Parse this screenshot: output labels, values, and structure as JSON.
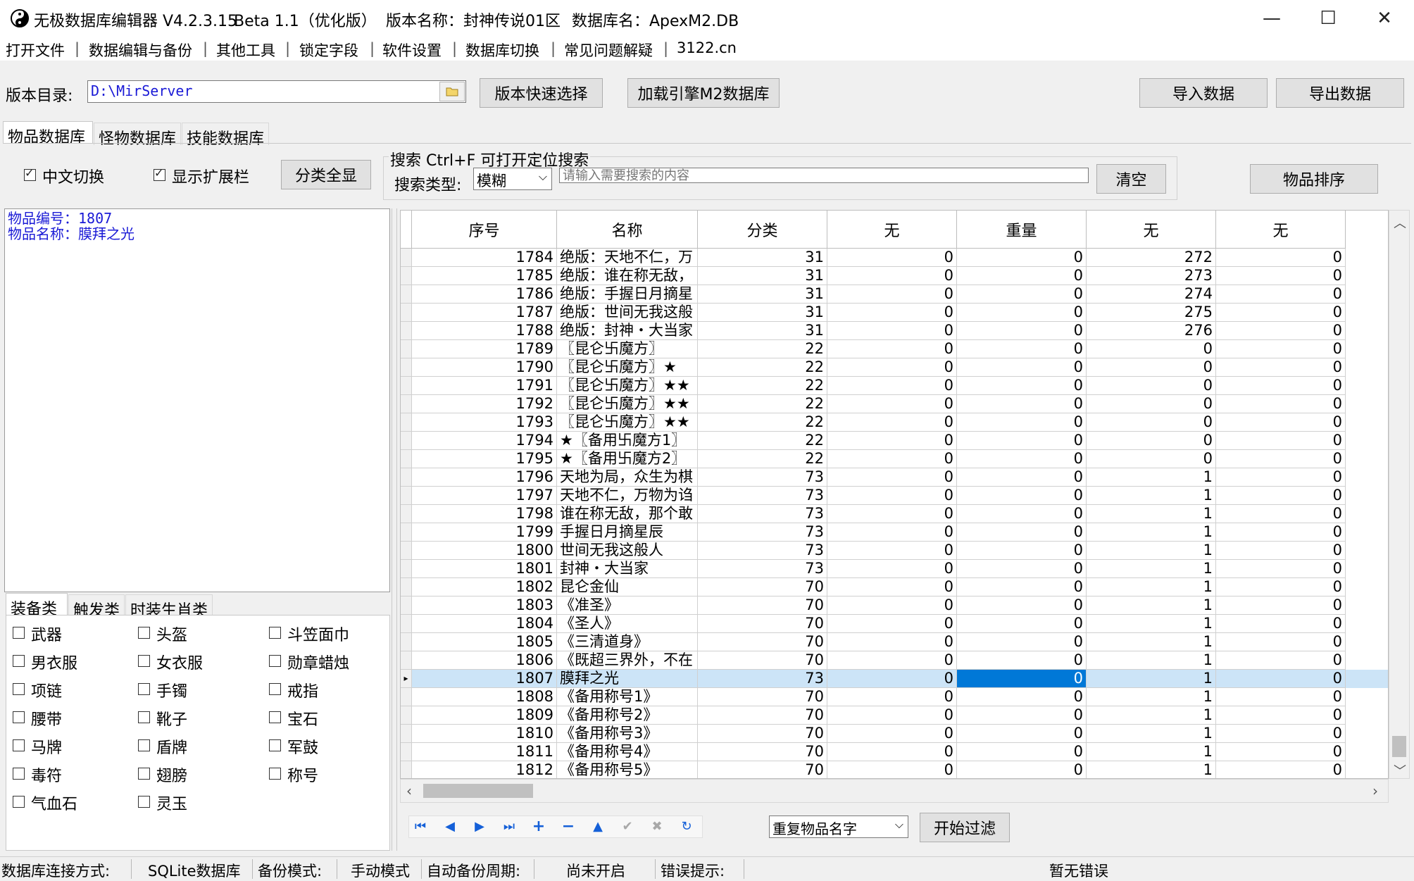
{
  "window": {
    "title_app": "无极数据库编辑器 V4.2.3.15",
    "title_edition": "Beta 1.1（优化版）",
    "title_version": "版本名称：封神传说01区",
    "title_db": "数据库名：ApexM2.DB",
    "minimize": "—",
    "maximize": "☐",
    "close": "✕"
  },
  "menu": [
    "打开文件",
    "数据编辑与备份",
    "其他工具",
    "锁定字段",
    "软件设置",
    "数据库切换",
    "常见问题解疑",
    "3122.cn"
  ],
  "toolbar": {
    "dir_label": "版本目录:",
    "dir_value": "D:\\MirServer",
    "quick_select": "版本快速选择",
    "load_engine": "加载引擎M2数据库",
    "import": "导入数据",
    "export": "导出数据"
  },
  "db_tabs": [
    "物品数据库",
    "怪物数据库",
    "技能数据库"
  ],
  "options": {
    "chinese_switch": "中文切换",
    "show_ext": "显示扩展栏",
    "show_all": "分类全显"
  },
  "search": {
    "group_title": "搜索  Ctrl+F 可打开定位搜索",
    "type_label": "搜索类型:",
    "type_value": "模糊",
    "placeholder": "请输入需要搜索的内容",
    "clear": "清空",
    "sort": "物品排序"
  },
  "info": {
    "line1": "物品编号：1807",
    "line2": "物品名称：膜拜之光"
  },
  "cat_tabs": [
    "装备类",
    "触发类",
    "时装生肖类"
  ],
  "categories": [
    [
      "武器",
      "头盔",
      "斗笠面巾"
    ],
    [
      "男衣服",
      "女衣服",
      "勋章蜡烛"
    ],
    [
      "项链",
      "手镯",
      "戒指"
    ],
    [
      "腰带",
      "靴子",
      "宝石"
    ],
    [
      "马牌",
      "盾牌",
      "军鼓"
    ],
    [
      "毒符",
      "翅膀",
      "称号"
    ],
    [
      "气血石",
      "灵玉"
    ]
  ],
  "grid": {
    "columns": [
      "序号",
      "名称",
      "分类",
      "无",
      "重量",
      "无",
      "无"
    ],
    "selected_id": "1807",
    "rows": [
      [
        "1784",
        "绝版：天地不仁，万",
        "31",
        "0",
        "0",
        "272",
        "0"
      ],
      [
        "1785",
        "绝版：谁在称无敌，",
        "31",
        "0",
        "0",
        "273",
        "0"
      ],
      [
        "1786",
        "绝版：手握日月摘星",
        "31",
        "0",
        "0",
        "274",
        "0"
      ],
      [
        "1787",
        "绝版：世间无我这般",
        "31",
        "0",
        "0",
        "275",
        "0"
      ],
      [
        "1788",
        "绝版：封神・大当家",
        "31",
        "0",
        "0",
        "276",
        "0"
      ],
      [
        "1789",
        "〖昆仑卐魔方〗",
        "22",
        "0",
        "0",
        "0",
        "0"
      ],
      [
        "1790",
        "〖昆仑卐魔方〗★",
        "22",
        "0",
        "0",
        "0",
        "0"
      ],
      [
        "1791",
        "〖昆仑卐魔方〗★★",
        "22",
        "0",
        "0",
        "0",
        "0"
      ],
      [
        "1792",
        "〖昆仑卐魔方〗★★",
        "22",
        "0",
        "0",
        "0",
        "0"
      ],
      [
        "1793",
        "〖昆仑卐魔方〗★★",
        "22",
        "0",
        "0",
        "0",
        "0"
      ],
      [
        "1794",
        "★〖备用卐魔方1〗",
        "22",
        "0",
        "0",
        "0",
        "0"
      ],
      [
        "1795",
        "★〖备用卐魔方2〗",
        "22",
        "0",
        "0",
        "0",
        "0"
      ],
      [
        "1796",
        "天地为局，众生为棋",
        "73",
        "0",
        "0",
        "1",
        "0"
      ],
      [
        "1797",
        "天地不仁，万物为诌",
        "73",
        "0",
        "0",
        "1",
        "0"
      ],
      [
        "1798",
        "谁在称无敌，那个敢",
        "73",
        "0",
        "0",
        "1",
        "0"
      ],
      [
        "1799",
        "手握日月摘星辰",
        "73",
        "0",
        "0",
        "1",
        "0"
      ],
      [
        "1800",
        "世间无我这般人",
        "73",
        "0",
        "0",
        "1",
        "0"
      ],
      [
        "1801",
        "封神・大当家",
        "73",
        "0",
        "0",
        "1",
        "0"
      ],
      [
        "1802",
        "昆仑金仙",
        "70",
        "0",
        "0",
        "1",
        "0"
      ],
      [
        "1803",
        "《准圣》",
        "70",
        "0",
        "0",
        "1",
        "0"
      ],
      [
        "1804",
        "《圣人》",
        "70",
        "0",
        "0",
        "1",
        "0"
      ],
      [
        "1805",
        "《三清道身》",
        "70",
        "0",
        "0",
        "1",
        "0"
      ],
      [
        "1806",
        "《既超三界外，不在",
        "70",
        "0",
        "0",
        "1",
        "0"
      ],
      [
        "1807",
        "膜拜之光",
        "73",
        "0",
        "0",
        "1",
        "0"
      ],
      [
        "1808",
        "《备用称号1》",
        "70",
        "0",
        "0",
        "1",
        "0"
      ],
      [
        "1809",
        "《备用称号2》",
        "70",
        "0",
        "0",
        "1",
        "0"
      ],
      [
        "1810",
        "《备用称号3》",
        "70",
        "0",
        "0",
        "1",
        "0"
      ],
      [
        "1811",
        "《备用称号4》",
        "70",
        "0",
        "0",
        "1",
        "0"
      ],
      [
        "1812",
        "《备用称号5》",
        "70",
        "0",
        "0",
        "1",
        "0"
      ]
    ]
  },
  "filter": {
    "value": "重复物品名字",
    "start": "开始过滤"
  },
  "status": {
    "conn_label": "数据库连接方式:",
    "conn_value": "SQLite数据库",
    "backup_label": "备份模式:",
    "backup_value": "手动模式",
    "auto_label": "自动备份周期:",
    "auto_value": "尚未开启",
    "err_label": "错误提示:",
    "err_value": "暂无错误"
  }
}
